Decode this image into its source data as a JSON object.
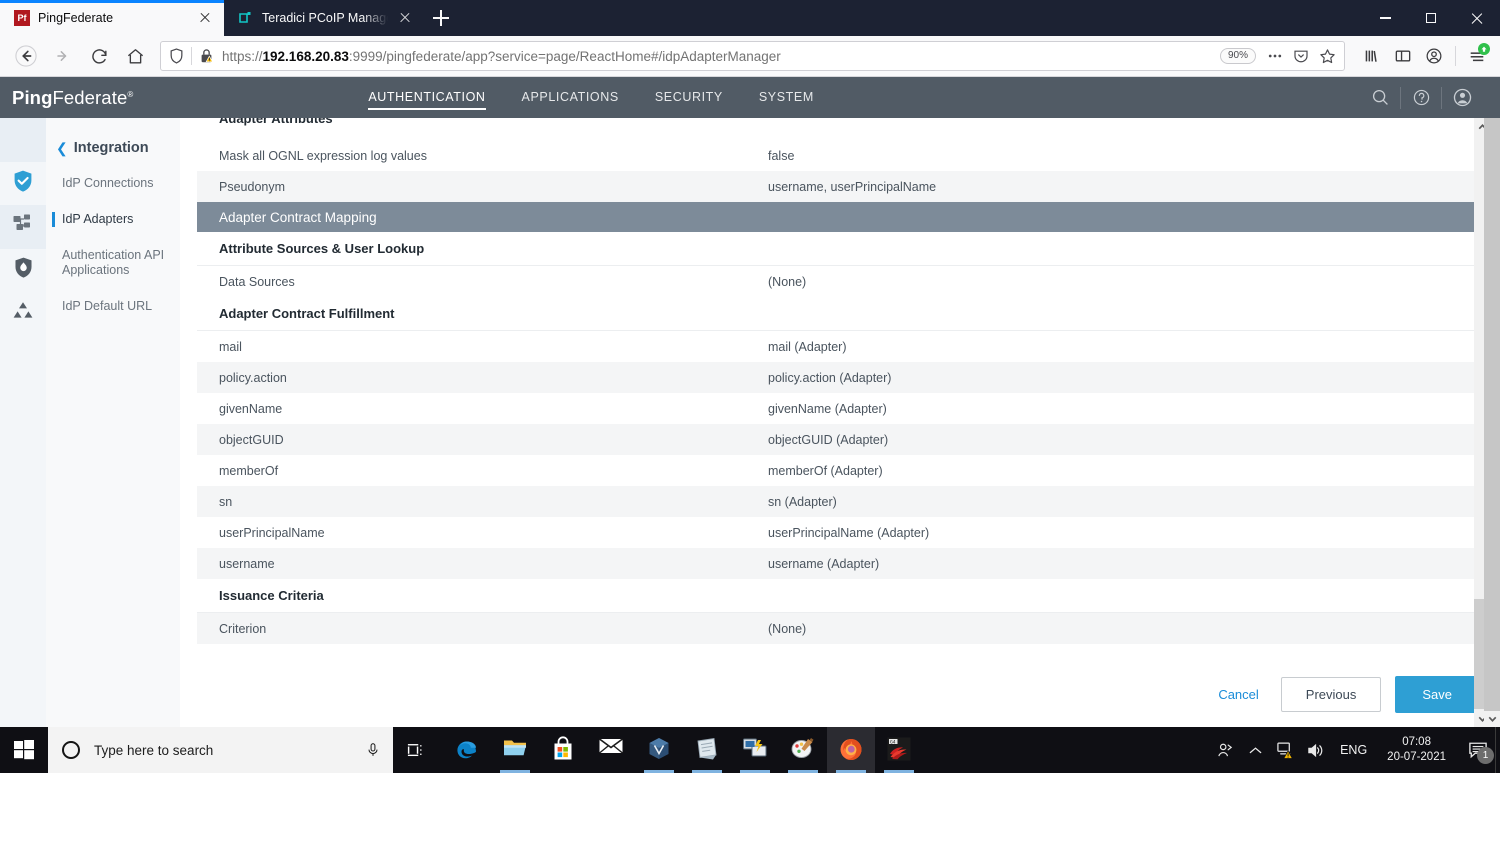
{
  "browser": {
    "tabs": [
      {
        "title": "PingFederate",
        "favicon": "pf-icon",
        "active": true
      },
      {
        "title": "Teradici PCoIP Management Co",
        "favicon": "teradici-icon",
        "active": false
      }
    ],
    "new_tab_label": "+",
    "window_controls": {
      "minimize": "minimize",
      "maximize": "maximize",
      "close": "close"
    },
    "nav": {
      "back": "back-arrow",
      "forward": "forward-arrow",
      "reload": "reload",
      "home": "home"
    },
    "url": {
      "scheme": "https://",
      "host_bold": "192.168.20.83",
      "rest": ":9999/pingfederate/app?service=page/ReactHome#/idpAdapterManager",
      "full": "https://192.168.20.83:9999/pingfederate/app?service=page/ReactHome#/idpAdapterManager",
      "zoom_level": "90%"
    },
    "toolbar_right": [
      "library-icon",
      "sidebar-icon",
      "account-icon",
      "menu-icon"
    ]
  },
  "pf": {
    "logo_bold": "Ping",
    "logo_light": "Federate",
    "nav": [
      {
        "label": "AUTHENTICATION",
        "active": true
      },
      {
        "label": "APPLICATIONS",
        "active": false
      },
      {
        "label": "SECURITY",
        "active": false
      },
      {
        "label": "SYSTEM",
        "active": false
      }
    ],
    "header_icons": [
      "search-icon",
      "help-icon",
      "user-avatar-icon"
    ],
    "sidebar": {
      "title": "Integration",
      "back_chevron": "chevron-left-icon",
      "items": [
        {
          "label": "IdP Connections",
          "selected": false,
          "icon": "shield-check-icon"
        },
        {
          "label": "IdP Adapters",
          "selected": true,
          "icon": "sitemap-icon"
        },
        {
          "label": "Authentication API Applications",
          "selected": false,
          "icon": "shield-flame-icon"
        },
        {
          "label": "IdP Default URL",
          "selected": false,
          "icon": "cluster-icon"
        }
      ]
    },
    "content": {
      "cut_section": "Adapter Attributes",
      "adapter_attribute_rows": [
        {
          "name": "Mask all OGNL expression log values",
          "value": "false",
          "alt": false
        },
        {
          "name": "Pseudonym",
          "value": "username, userPrincipalName",
          "alt": true
        }
      ],
      "band_title": "Adapter Contract Mapping",
      "attribute_sources_heading": "Attribute Sources & User Lookup",
      "data_sources_row": {
        "name": "Data Sources",
        "value": "(None)",
        "alt": false
      },
      "fulfillment_heading": "Adapter Contract Fulfillment",
      "fulfillment_rows": [
        {
          "name": "mail",
          "value": "mail (Adapter)",
          "alt": false
        },
        {
          "name": "policy.action",
          "value": "policy.action (Adapter)",
          "alt": true
        },
        {
          "name": "givenName",
          "value": "givenName (Adapter)",
          "alt": false
        },
        {
          "name": "objectGUID",
          "value": "objectGUID (Adapter)",
          "alt": true
        },
        {
          "name": "memberOf",
          "value": "memberOf (Adapter)",
          "alt": false
        },
        {
          "name": "sn",
          "value": "sn (Adapter)",
          "alt": true
        },
        {
          "name": "userPrincipalName",
          "value": "userPrincipalName (Adapter)",
          "alt": false
        },
        {
          "name": "username",
          "value": "username (Adapter)",
          "alt": true
        }
      ],
      "issuance_heading": "Issuance Criteria",
      "criterion_row": {
        "name": "Criterion",
        "value": "(None)",
        "alt": true
      }
    },
    "actions": {
      "cancel": "Cancel",
      "previous": "Previous",
      "save": "Save"
    },
    "colors": {
      "accent": "#2e9fd4",
      "header": "#515b65",
      "band": "#7d8b99",
      "link": "#1a8cd8"
    }
  },
  "taskbar": {
    "start": "windows-start-icon",
    "search_placeholder": "Type here to search",
    "mic": "microphone-icon",
    "task_view": "task-view-icon",
    "apps": [
      {
        "name": "edge-icon",
        "active": false,
        "open": false
      },
      {
        "name": "file-explorer-icon",
        "active": false,
        "open": true
      },
      {
        "name": "microsoft-store-icon",
        "active": false,
        "open": false
      },
      {
        "name": "mail-icon",
        "active": false,
        "open": false
      },
      {
        "name": "virtualbox-icon",
        "active": false,
        "open": true
      },
      {
        "name": "sticky-notes-icon",
        "active": false,
        "open": true
      },
      {
        "name": "remote-desktop-icon",
        "active": false,
        "open": true
      },
      {
        "name": "paint-icon",
        "active": false,
        "open": true
      },
      {
        "name": "firefox-icon",
        "active": true,
        "open": true
      },
      {
        "name": "red-app-icon",
        "active": false,
        "open": true
      }
    ],
    "tray": {
      "people": "people-icon",
      "chevron": "chevron-up-icon",
      "network": "network-warning-icon",
      "volume": "volume-icon",
      "language": "ENG",
      "time": "07:08",
      "date": "20-07-2021",
      "notification": "notification-icon",
      "notification_count": "1"
    }
  }
}
